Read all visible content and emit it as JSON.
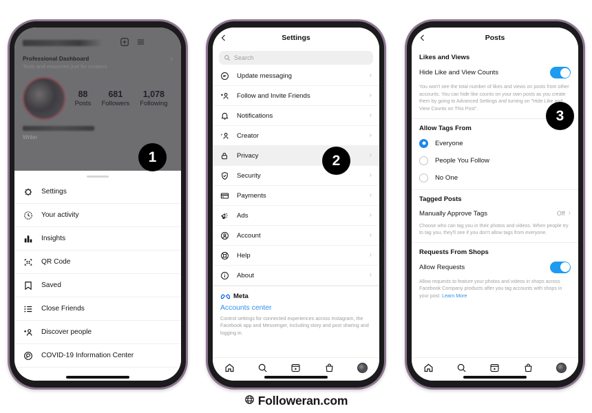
{
  "footer": {
    "brand": "Followeran.com",
    "icon": "globe-icon"
  },
  "badges": {
    "one": "1",
    "two": "2",
    "three": "3"
  },
  "colors": {
    "toggle_on": "#1c9bf0",
    "radio_selected": "#1c87e8",
    "link_blue": "#2d90e8",
    "badge_bg": "#000000",
    "phone_frame": "#8d7790"
  },
  "phone1": {
    "profile": {
      "username_redacted": "",
      "add_icon": "plus-box-icon",
      "menu_icon": "hamburger-icon",
      "dashboard_title": "Professional Dashboard",
      "dashboard_subtitle": "Tools and resources just for creators",
      "stats": [
        {
          "num": "88",
          "label": "Posts"
        },
        {
          "num": "681",
          "label": "Followers"
        },
        {
          "num": "1,078",
          "label": "Following"
        }
      ],
      "display_name_redacted": "",
      "bio": "Writer"
    },
    "sheet_items": [
      {
        "label": "Settings",
        "icon": "gear-icon"
      },
      {
        "label": "Your activity",
        "icon": "clock-activity-icon"
      },
      {
        "label": "Insights",
        "icon": "bar-chart-icon"
      },
      {
        "label": "QR Code",
        "icon": "qr-code-icon"
      },
      {
        "label": "Saved",
        "icon": "bookmark-icon"
      },
      {
        "label": "Close Friends",
        "icon": "list-star-icon"
      },
      {
        "label": "Discover people",
        "icon": "add-person-icon"
      },
      {
        "label": "COVID-19 Information Center",
        "icon": "covid-info-icon"
      }
    ],
    "tabbar": [
      "home-icon",
      "search-icon",
      "reels-icon",
      "shop-icon",
      "profile-avatar"
    ]
  },
  "phone2": {
    "nav": {
      "back": "chevron-left-icon",
      "title": "Settings"
    },
    "search": {
      "placeholder": "Search",
      "value": "",
      "icon": "search-icon"
    },
    "items": [
      {
        "label": "Update messaging",
        "icon": "messenger-icon",
        "chev": "›",
        "highlight": false
      },
      {
        "label": "Follow and Invite Friends",
        "icon": "add-person-icon",
        "chev": "›",
        "highlight": false
      },
      {
        "label": "Notifications",
        "icon": "bell-icon",
        "chev": "›",
        "highlight": false
      },
      {
        "label": "Creator",
        "icon": "creator-person-icon",
        "chev": "›",
        "highlight": false
      },
      {
        "label": "Privacy",
        "icon": "lock-icon",
        "chev": "›",
        "highlight": true
      },
      {
        "label": "Security",
        "icon": "shield-check-icon",
        "chev": "›",
        "highlight": false
      },
      {
        "label": "Payments",
        "icon": "card-icon",
        "chev": "›",
        "highlight": false
      },
      {
        "label": "Ads",
        "icon": "megaphone-icon",
        "chev": "›",
        "highlight": false
      },
      {
        "label": "Account",
        "icon": "account-circle-icon",
        "chev": "›",
        "highlight": false
      },
      {
        "label": "Help",
        "icon": "life-ring-icon",
        "chev": "›",
        "highlight": false
      },
      {
        "label": "About",
        "icon": "info-circle-icon",
        "chev": "›",
        "highlight": false
      }
    ],
    "meta": {
      "logo_label": "Meta",
      "accounts_center": "Accounts center",
      "description": "Control settings for connected experiences across Instagram, the Facebook app and Messenger, including story and post sharing and logging in."
    },
    "tabbar": [
      "home-icon",
      "search-icon",
      "reels-icon",
      "shop-icon",
      "profile-avatar"
    ]
  },
  "phone3": {
    "nav": {
      "back": "chevron-left-icon",
      "title": "Posts"
    },
    "likes_section": {
      "title": "Likes and Views",
      "row_label": "Hide Like and View Counts",
      "toggle_state": "on",
      "help": "You won't see the total number of likes and views on posts from other accounts. You can hide like counts on your own posts as you create them by going to Advanced Settings and turning on \"Hide Like and View Counts on This Post\"."
    },
    "tags_section": {
      "title": "Allow Tags From",
      "options": [
        {
          "label": "Everyone",
          "selected": true
        },
        {
          "label": "People You Follow",
          "selected": false
        },
        {
          "label": "No One",
          "selected": false
        }
      ]
    },
    "tagged_section": {
      "title": "Tagged Posts",
      "row_label": "Manually Approve Tags",
      "row_value": "Off",
      "chev": "›",
      "help": "Choose who can tag you in their photos and videos. When people try to tag you, they'll see if you don't allow tags from everyone."
    },
    "shops_section": {
      "title": "Requests From Shops",
      "row_label": "Allow Requests",
      "toggle_state": "on",
      "help_prefix": "Allow requests to feature your photos and videos in shops across Facebook Company products after you tag accounts with shops in your post. ",
      "help_link": "Learn More"
    },
    "tabbar": [
      "home-icon",
      "search-icon",
      "reels-icon",
      "shop-icon",
      "profile-avatar"
    ]
  }
}
